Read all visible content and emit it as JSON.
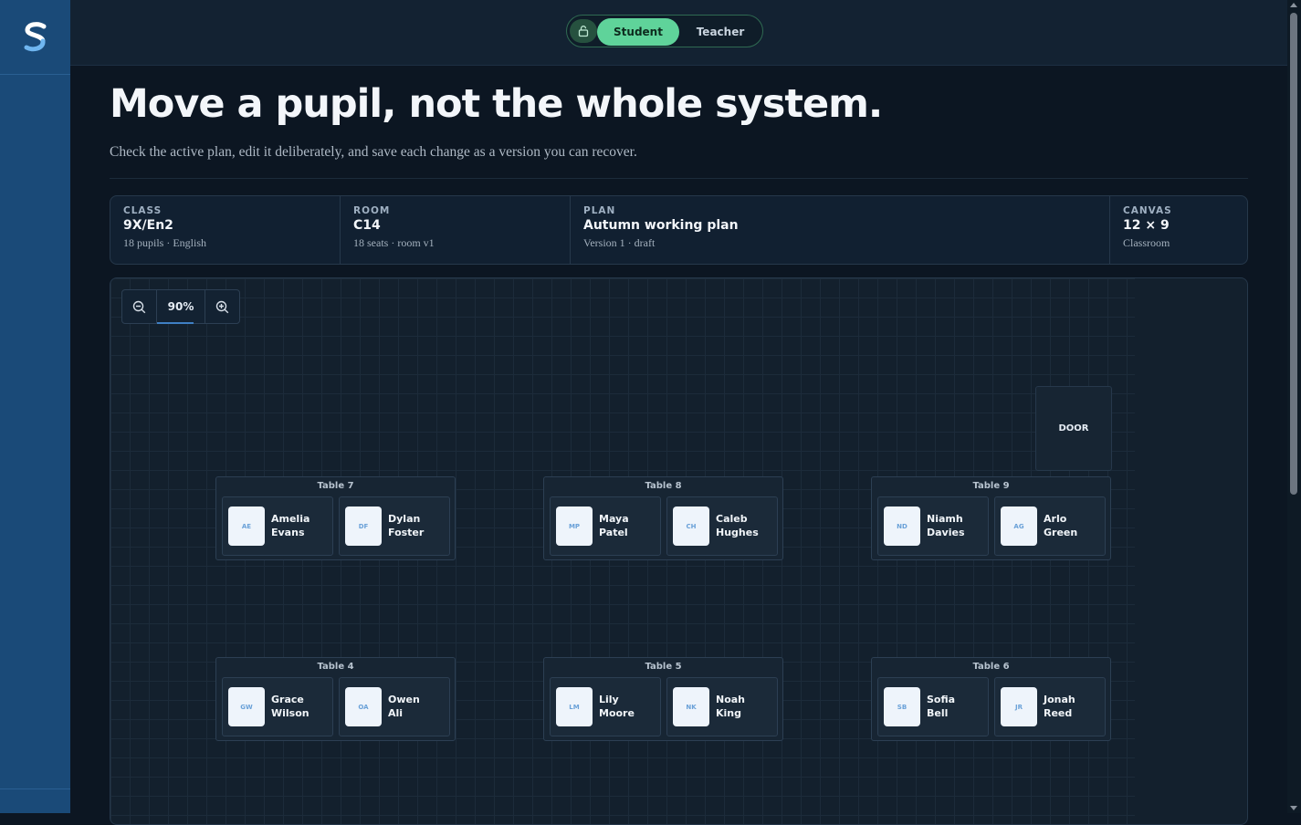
{
  "mode_toggle": {
    "student_label": "Student",
    "teacher_label": "Teacher",
    "active": "Student"
  },
  "header": {
    "title": "Move a pupil, not the whole system.",
    "subtitle": "Check the active plan, edit it deliberately, and save each change as a version you can recover."
  },
  "info": {
    "class": {
      "label": "CLASS",
      "value": "9X/En2",
      "sub": "18 pupils · English"
    },
    "room": {
      "label": "ROOM",
      "value": "C14",
      "sub": "18 seats · room v1"
    },
    "plan": {
      "label": "PLAN",
      "value": "Autumn working plan",
      "sub": "Version 1 · draft"
    },
    "canvas": {
      "label": "CANVAS",
      "value": "12 × 9",
      "sub": "Classroom"
    }
  },
  "zoom": {
    "value": "90%"
  },
  "door_label": "DOOR",
  "tables": [
    {
      "label": "Table 7",
      "seats": [
        {
          "initials": "AE",
          "first": "Amelia",
          "last": "Evans"
        },
        {
          "initials": "DF",
          "first": "Dylan",
          "last": "Foster"
        }
      ]
    },
    {
      "label": "Table 8",
      "seats": [
        {
          "initials": "MP",
          "first": "Maya",
          "last": "Patel"
        },
        {
          "initials": "CH",
          "first": "Caleb",
          "last": "Hughes"
        }
      ]
    },
    {
      "label": "Table 9",
      "seats": [
        {
          "initials": "ND",
          "first": "Niamh",
          "last": "Davies"
        },
        {
          "initials": "AG",
          "first": "Arlo",
          "last": "Green"
        }
      ]
    },
    {
      "label": "Table 4",
      "seats": [
        {
          "initials": "GW",
          "first": "Grace",
          "last": "Wilson"
        },
        {
          "initials": "OA",
          "first": "Owen",
          "last": "Ali"
        }
      ]
    },
    {
      "label": "Table 5",
      "seats": [
        {
          "initials": "LM",
          "first": "Lily",
          "last": "Moore"
        },
        {
          "initials": "NK",
          "first": "Noah",
          "last": "King"
        }
      ]
    },
    {
      "label": "Table 6",
      "seats": [
        {
          "initials": "SB",
          "first": "Sofia",
          "last": "Bell"
        },
        {
          "initials": "JR",
          "first": "Jonah",
          "last": "Reed"
        }
      ]
    }
  ],
  "icons": {
    "logo": "s-logo-icon",
    "lock": "lock-icon",
    "zoom_out": "zoom-out-icon",
    "zoom_in": "zoom-in-icon"
  },
  "colors": {
    "accent_green": "#5fd39a",
    "sidebar_blue": "#1a4a78",
    "background": "#0c1622"
  }
}
